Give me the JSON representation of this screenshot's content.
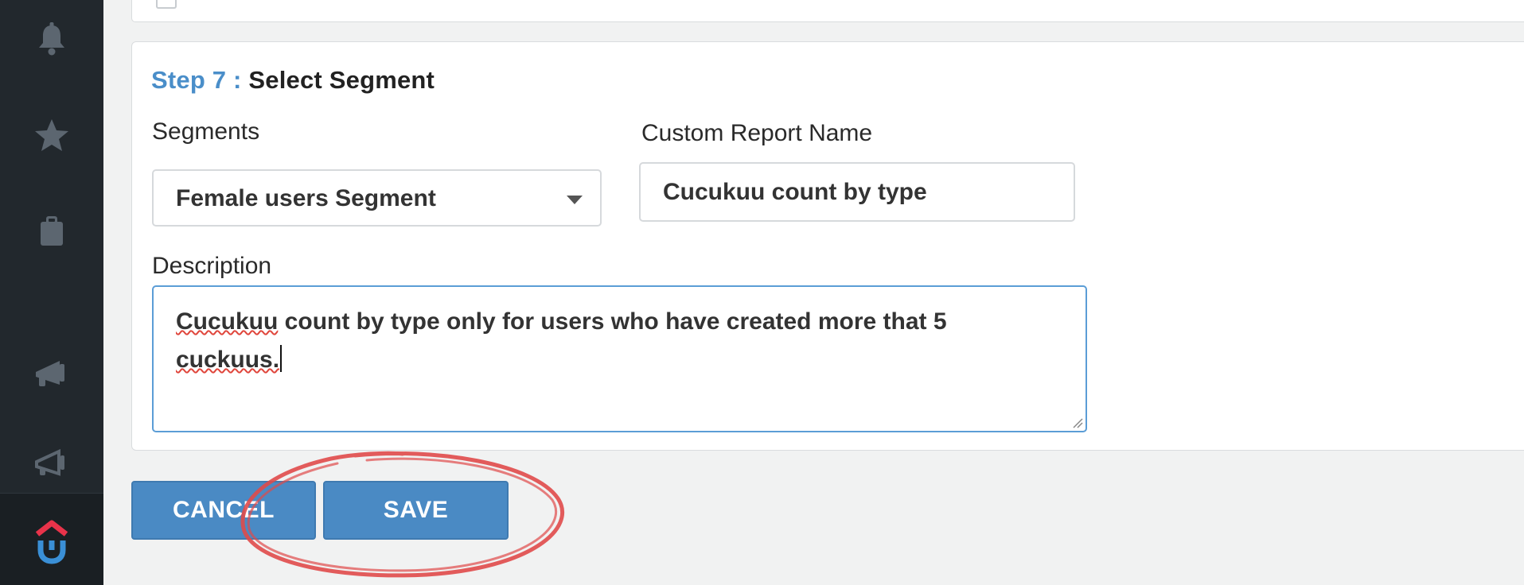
{
  "sidebar": {
    "icons": [
      {
        "name": "bell-icon"
      },
      {
        "name": "star-icon"
      },
      {
        "name": "clipboard-icon"
      },
      {
        "name": "megaphone-icon"
      },
      {
        "name": "megaphone-outline-icon"
      },
      {
        "name": "app-logo-icon"
      }
    ]
  },
  "step": {
    "number_label": "Step 7 :",
    "title": "Select Segment"
  },
  "segments": {
    "label": "Segments",
    "selected": "Female users Segment"
  },
  "report_name": {
    "label": "Custom Report Name",
    "value": "Cucukuu count by type"
  },
  "description": {
    "label": "Description",
    "line1_word1": "Cucukuu",
    "line1_rest": " count by type only for users who have created more that 5",
    "line2_word": "cuckuus."
  },
  "actions": {
    "cancel_label": "CANCEL",
    "save_label": "SAVE"
  },
  "colors": {
    "accent": "#4a8ac4",
    "step_number": "#4a8ec9",
    "sidebar_bg": "#22282d",
    "annotation": "#e04a4a",
    "logo_red": "#e8334a",
    "logo_blue": "#3a8fd6"
  }
}
